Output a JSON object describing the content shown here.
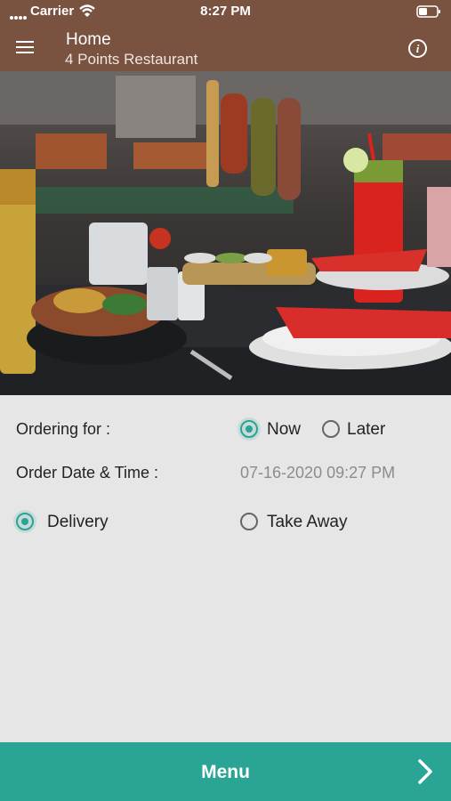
{
  "status": {
    "carrier": "Carrier",
    "time": "8:27 PM"
  },
  "header": {
    "title": "Home",
    "subtitle": "4 Points Restaurant"
  },
  "hero": {
    "image_alt": "Restaurant dishes photo"
  },
  "ordering": {
    "label": "Ordering for :",
    "options": [
      {
        "label": "Now",
        "selected": true
      },
      {
        "label": "Later",
        "selected": false
      }
    ]
  },
  "order_time": {
    "label": "Order Date & Time :",
    "value": "07-16-2020 09:27 PM"
  },
  "fulfilment": {
    "options": [
      {
        "label": "Delivery",
        "selected": true
      },
      {
        "label": "Take Away",
        "selected": false
      }
    ]
  },
  "footer": {
    "menu_label": "Menu"
  },
  "colors": {
    "brand_brown": "#7a5240",
    "accent_teal": "#2aa494"
  }
}
